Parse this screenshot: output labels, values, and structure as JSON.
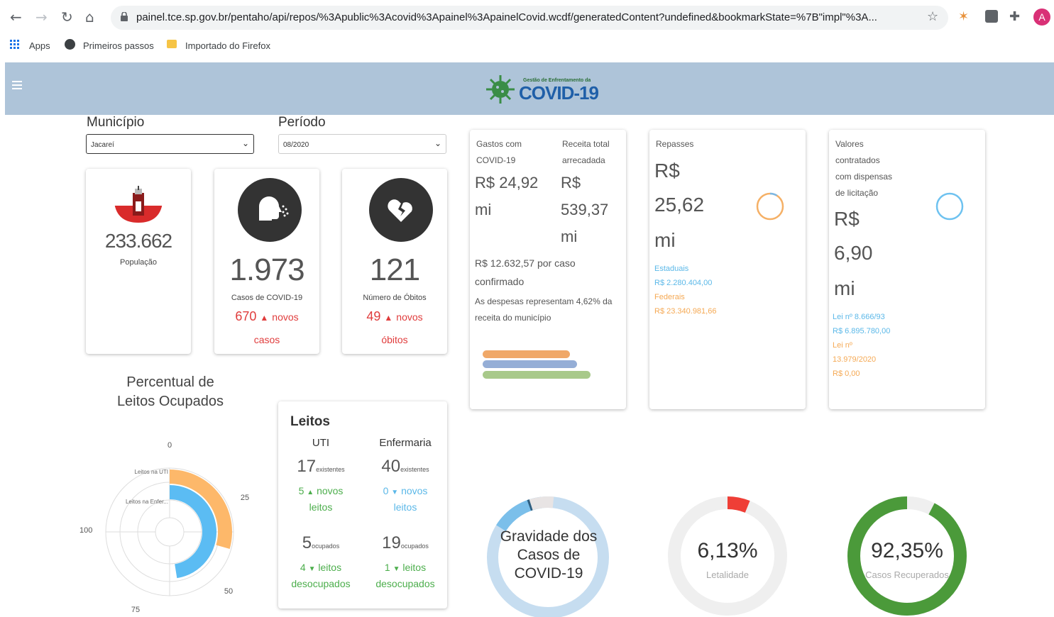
{
  "browser": {
    "url": "painel.tce.sp.gov.br/pentaho/api/repos/%3Apublic%3Acovid%3Apainel%3ApainelCovid.wcdf/generatedContent?undefined&bookmarkState=%7B\"impl\"%3A...",
    "profile_initial": "A",
    "bookmarks": [
      "Apps",
      "Primeiros passos",
      "Importado do Firefox"
    ]
  },
  "header": {
    "logo_subtitle": "Gestão de Enfrentamento da",
    "logo_title": "COVID-19"
  },
  "filters": {
    "municipio_label": "Município",
    "municipio_value": "Jacareí",
    "periodo_label": "Período",
    "periodo_value": "08/2020"
  },
  "population": {
    "value": "233.662",
    "label": "População"
  },
  "cases": {
    "value": "1.973",
    "label": "Casos de COVID-19",
    "new_value": "670",
    "new_label": "novos",
    "new_label2": "casos"
  },
  "deaths": {
    "value": "121",
    "label": "Número de Óbitos",
    "new_value": "49",
    "new_label": "novos",
    "new_label2": "óbitos"
  },
  "gastos": {
    "col1_title_1": "Gastos com",
    "col1_title_2": "COVID-19",
    "col1_value_1": "R$ 24,92",
    "col1_value_2": "mi",
    "col2_title_1": "Receita total",
    "col2_title_2": "arrecadada",
    "col2_value_1": "R$",
    "col2_value_2": "539,37",
    "col2_value_3": "mi",
    "per_case_1": "R$ 12.632,57 por caso",
    "per_case_2": "confirmado",
    "despesas_1": "As despesas representam 4,62% da",
    "despesas_2": "receita do município",
    "bar_colors": [
      "#f0a868",
      "#95aed6",
      "#a8c98a"
    ]
  },
  "repasses": {
    "title": "Repasses",
    "value_1": "R$",
    "value_2": "25,62",
    "value_3": "mi",
    "estaduais_label": "Estaduais",
    "estaduais_value": "R$ 2.280.404,00",
    "federais_label": "Federais",
    "federais_value": "R$ 23.340.981,66"
  },
  "contratados": {
    "title_1": "Valores",
    "title_2": "contratados",
    "title_3": "com dispensas",
    "title_4": "de licitação",
    "value_1": "R$",
    "value_2": "6,90",
    "value_3": "mi",
    "lei1_label": "Lei nº 8.666/93",
    "lei1_value": "R$ 6.895.780,00",
    "lei2_label_1": "Lei nº",
    "lei2_label_2": "13.979/2020",
    "lei2_value": "R$ 0,00"
  },
  "leitos_chart": {
    "title_1": "Percentual de",
    "title_2": "Leitos Ocupados",
    "tick_0": "0",
    "tick_25": "25",
    "tick_50": "50",
    "tick_75": "75",
    "tick_100": "100",
    "label_uti": "Leitos na UTI",
    "label_enf": "Leitos na Enfer...",
    "colors": {
      "uti": "#fdb86a",
      "enf": "#5bbcf3"
    }
  },
  "chart_data": {
    "type": "bar",
    "orientation": "radial",
    "title": "Percentual de Leitos Ocupados",
    "categories": [
      "Leitos na UTI",
      "Leitos na Enfer..."
    ],
    "values": [
      29.4,
      47.5
    ],
    "ylim": [
      0,
      100
    ],
    "ticks": [
      0,
      25,
      50,
      75,
      100
    ]
  },
  "leitos": {
    "title": "Leitos",
    "uti_label": "UTI",
    "enf_label": "Enfermaria",
    "uti_existentes": "17",
    "enf_existentes": "40",
    "existentes_label": "existentes",
    "uti_novos": "5",
    "enf_novos": "0",
    "novos_label": "novos",
    "leitos_word": "leitos",
    "uti_ocupados": "5",
    "enf_ocupados": "19",
    "ocupados_label": "ocupados",
    "uti_desocupados": "4",
    "enf_desocupados": "1",
    "desocupados_label": "desocupados"
  },
  "gravidade": {
    "line1": "Gravidade dos",
    "line2": "Casos de",
    "line3": "COVID-19"
  },
  "letalidade": {
    "value": "6,13%",
    "label": "Letalidade",
    "fraction": 0.0613
  },
  "recuperados": {
    "value": "92,35%",
    "label": "Casos Recuperados",
    "fraction": 0.9235
  }
}
